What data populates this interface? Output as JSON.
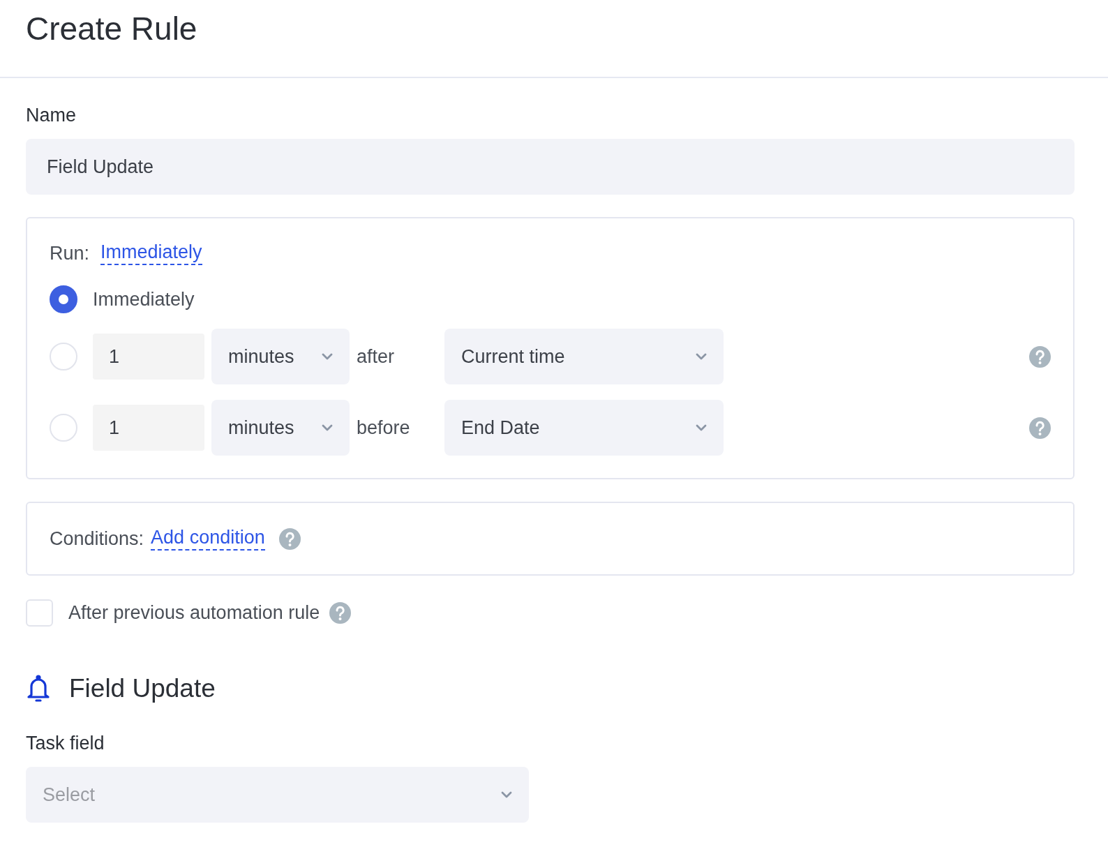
{
  "page": {
    "title": "Create Rule"
  },
  "name_field": {
    "label": "Name",
    "value": "Field Update"
  },
  "run": {
    "label": "Run:",
    "link": "Immediately",
    "options": [
      {
        "kind": "plain",
        "selected": true,
        "label": "Immediately"
      },
      {
        "kind": "offset",
        "selected": false,
        "amount": "1",
        "unit": "minutes",
        "relation": "after",
        "anchor": "Current time"
      },
      {
        "kind": "offset",
        "selected": false,
        "amount": "1",
        "unit": "minutes",
        "relation": "before",
        "anchor": "End Date"
      }
    ]
  },
  "conditions": {
    "label": "Conditions:",
    "link": "Add condition"
  },
  "after_previous": {
    "label": "After previous automation rule",
    "checked": false
  },
  "action": {
    "title": "Field Update",
    "task_field": {
      "label": "Task field",
      "placeholder": "Select"
    }
  }
}
